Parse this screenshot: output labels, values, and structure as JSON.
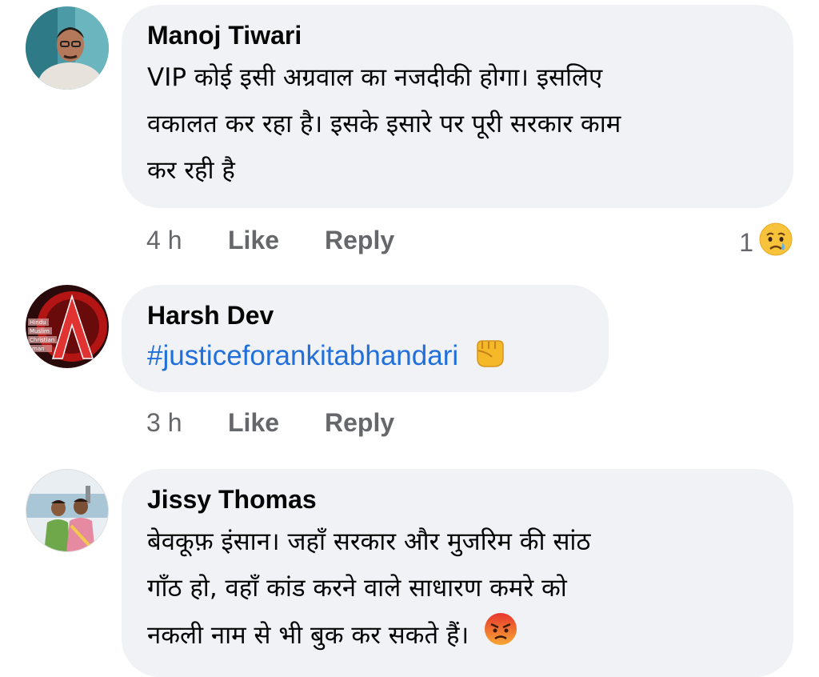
{
  "comments": [
    {
      "author": "Manoj Tiwari",
      "lines": [
        "VIP कोई इसी अग्रवाल का नजदीकी होगा। इसलिए",
        "वकालत कर रहा है। इसके इसारे पर पूरी सरकार काम",
        "कर रही है"
      ],
      "time": "4 h",
      "like": "Like",
      "reply": "Reply",
      "reaction_count": "1",
      "reaction_icon": "crying-face-icon"
    },
    {
      "author": "Harsh Dev",
      "hashtag": "#justiceforankitabhandari",
      "trailing_icon": "raised-fist-icon",
      "time": "3 h",
      "like": "Like",
      "reply": "Reply"
    },
    {
      "author": "Jissy Thomas",
      "lines": [
        "बेवकूफ़ इंसान। जहाँ सरकार और मुजरिम की सांठ",
        "गाँठ हो, वहाँ कांड करने वाले साधारण कमरे को",
        "नकली नाम से भी बुक कर सकते हैं।"
      ],
      "trailing_icon": "angry-face-icon"
    }
  ],
  "avatar_logo_text": [
    "Hindu",
    "Muslim",
    "Christian",
    "man"
  ],
  "colors": {
    "bubble": "#f0f2f5",
    "meta": "#65676b",
    "link": "#216fdb",
    "text": "#050505"
  }
}
